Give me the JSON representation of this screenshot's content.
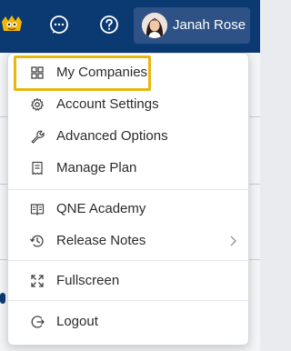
{
  "header": {
    "user_name": "Janah Rose"
  },
  "icons": {
    "mascot": "mascot-icon",
    "chat": "chat-icon",
    "help": "help-icon",
    "avatar": "avatar"
  },
  "colors": {
    "topbar": "#0b3a73",
    "user_button": "#2e5285",
    "highlight": "#e8b70f"
  },
  "menu": {
    "items": [
      {
        "label": "My Companies",
        "icon": "grid-icon",
        "highlighted": true
      },
      {
        "label": "Account Settings",
        "icon": "gear-icon"
      },
      {
        "label": "Advanced Options",
        "icon": "wrench-icon"
      },
      {
        "label": "Manage Plan",
        "icon": "receipt-icon"
      },
      {
        "label": "QNE Academy",
        "icon": "book-icon"
      },
      {
        "label": "Release Notes",
        "icon": "history-icon",
        "submenu": true
      },
      {
        "label": "Fullscreen",
        "icon": "fullscreen-icon"
      },
      {
        "label": "Logout",
        "icon": "logout-icon"
      }
    ]
  }
}
